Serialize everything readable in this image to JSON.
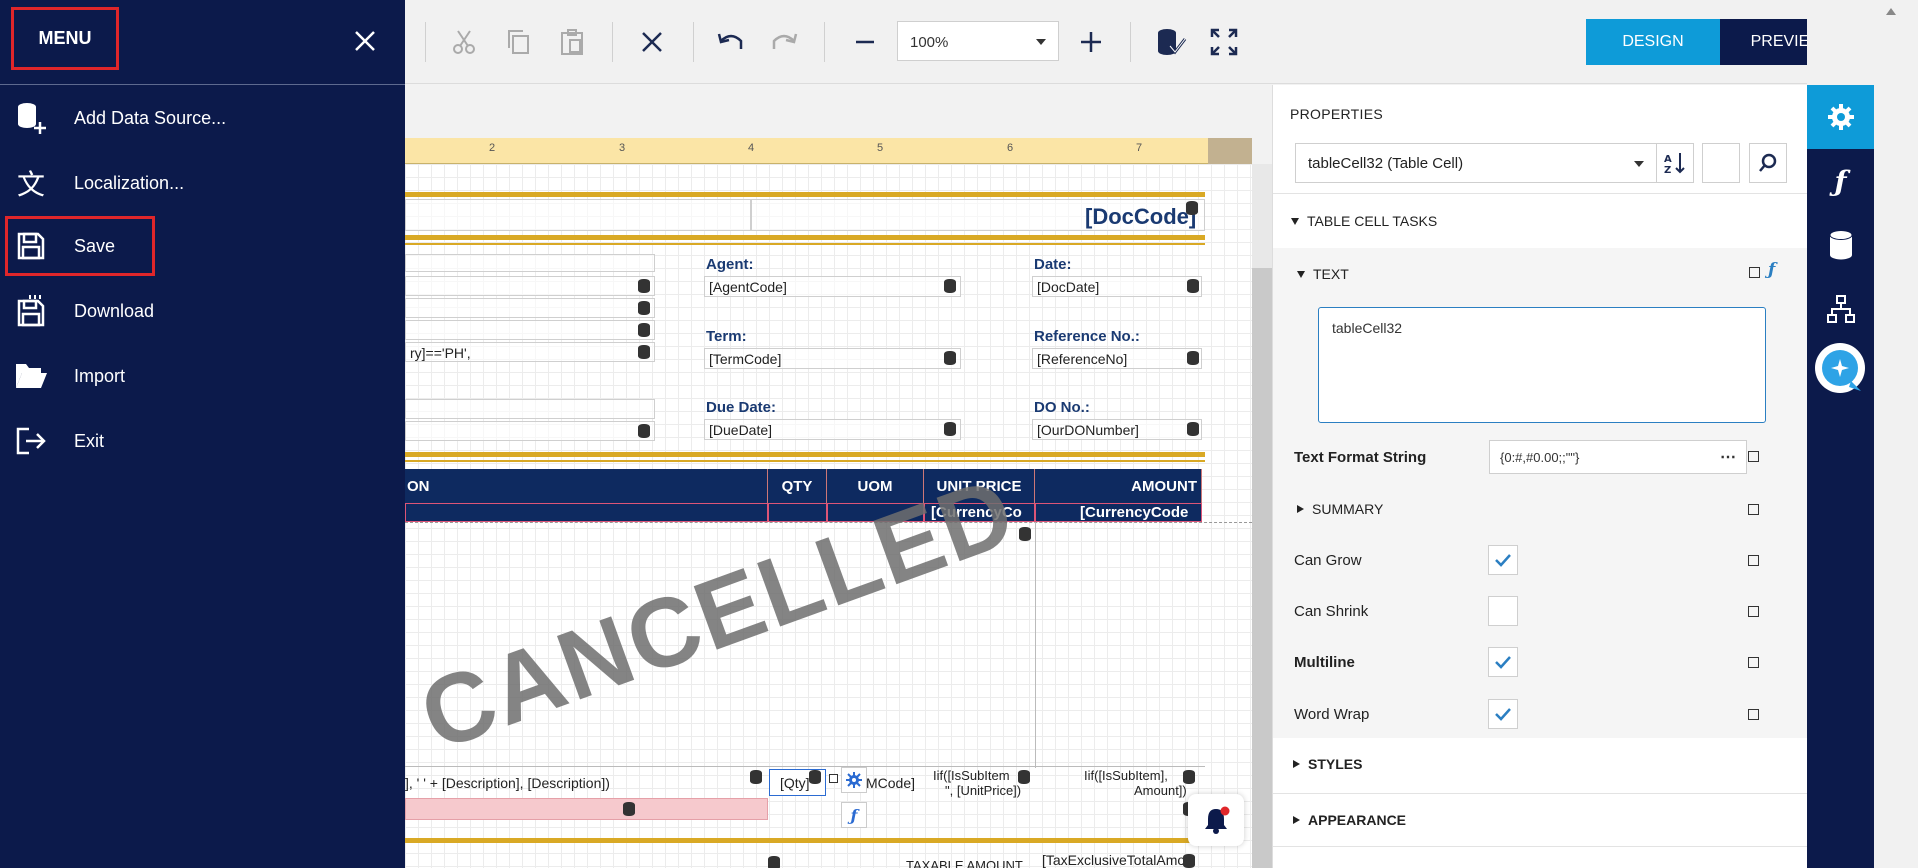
{
  "toolbar": {
    "zoom_value": "100%",
    "design_label": "DESIGN",
    "preview_label": "PREVIEW"
  },
  "menu": {
    "title": "MENU",
    "items": [
      {
        "label": "Add Data Source...",
        "icon": "database-add-icon"
      },
      {
        "label": "Localization...",
        "icon": "localization-icon"
      },
      {
        "label": "Save",
        "icon": "save-icon"
      },
      {
        "label": "Download",
        "icon": "download-icon"
      },
      {
        "label": "Import",
        "icon": "folder-open-icon"
      },
      {
        "label": "Exit",
        "icon": "exit-icon"
      }
    ]
  },
  "ruler": {
    "ticks": [
      "2",
      "3",
      "4",
      "5",
      "6",
      "7"
    ]
  },
  "report": {
    "doc_code": "[DocCode]",
    "agent_label": "Agent:",
    "agent_value": "[AgentCode]",
    "date_label": "Date:",
    "date_value": "[DocDate]",
    "term_label": "Term:",
    "term_value": "[TermCode]",
    "ref_label": "Reference No.:",
    "ref_value": "[ReferenceNo]",
    "due_label": "Due Date:",
    "due_value": "[DueDate]",
    "do_label": "DO No.:",
    "do_value": "[OurDONumber]",
    "country_expr": "ry]=='PH',",
    "col_on": "ON",
    "col_qty": "QTY",
    "col_uom": "UOM",
    "col_unit_price": "UNIT PRICE",
    "col_amount": "AMOUNT",
    "currency1": "[CurrencyCo",
    "currency2": "[CurrencyCode",
    "stamp": "CANCELLED",
    "desc_expr": "], '   ' + [Description], [Description])",
    "qty_cell": "[Qty]",
    "uom_cell": "MCode]",
    "unit_price_cell_1": "Iif([IsSubItem",
    "unit_price_cell_2": "\", [UnitPrice])",
    "amount_cell_1": "Iif([IsSubItem],",
    "amount_cell_2": "Amount])",
    "taxable_label": "TAXABLE AMOUNT",
    "tax_excl": "[TaxExclusiveTotalAmo"
  },
  "properties": {
    "title": "PROPERTIES",
    "selected_component": "tableCell32 (Table Cell)",
    "section_tasks": "TABLE CELL TASKS",
    "section_text": "TEXT",
    "text_value": "tableCell32",
    "text_format_label": "Text Format String",
    "text_format_value": "{0:#,#0.00;;\"\"}",
    "summary_label": "SUMMARY",
    "can_grow_label": "Can Grow",
    "can_grow": true,
    "can_shrink_label": "Can Shrink",
    "can_shrink": false,
    "multiline_label": "Multiline",
    "multiline": true,
    "word_wrap_label": "Word Wrap",
    "word_wrap": true,
    "styles_label": "STYLES",
    "appearance_label": "APPEARANCE"
  },
  "colors": {
    "menu_bg": "#0c1a4b",
    "accent_blue": "#0e9bd8",
    "highlight_red": "#e0262a",
    "report_gold": "#d9a925",
    "header_navy": "#0e2a60"
  }
}
